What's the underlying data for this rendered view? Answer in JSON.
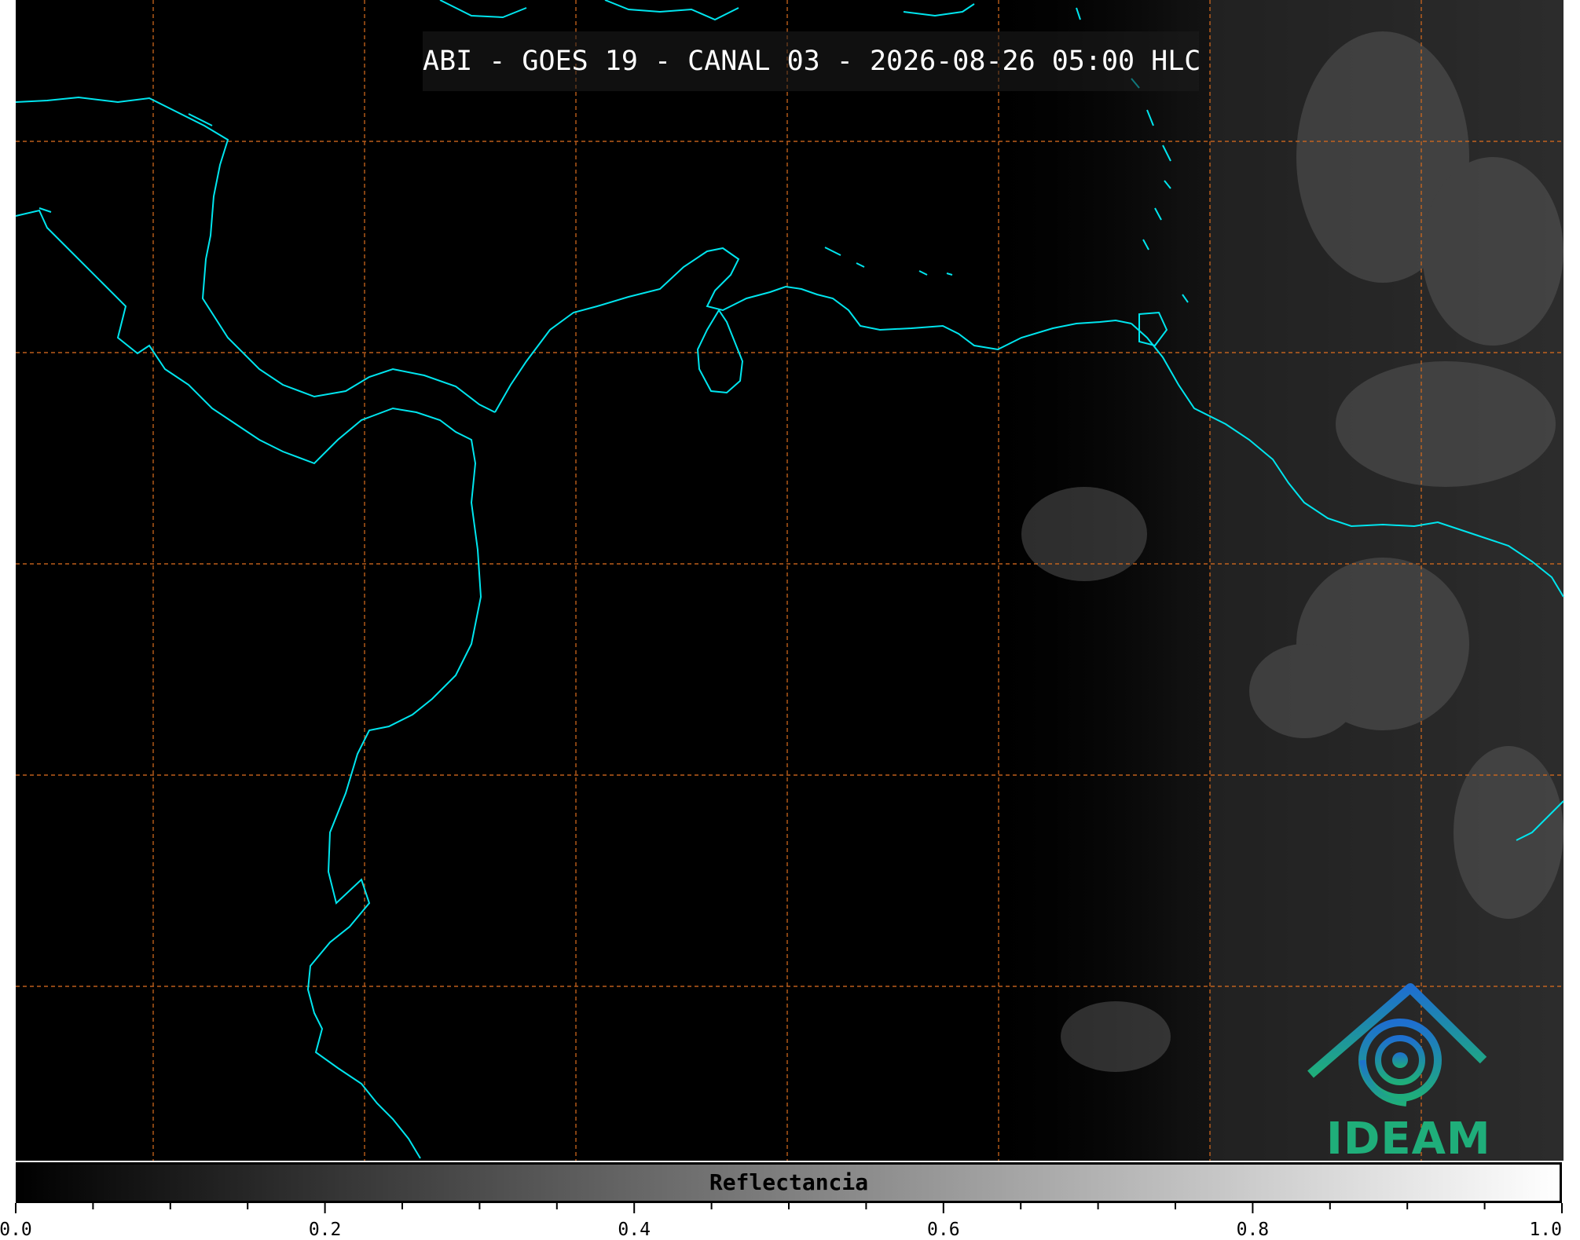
{
  "title": "ABI - GOES 19 - CANAL 03 - 2026-08-26 05:00 HLC",
  "logo": {
    "text": "IDEAM",
    "colors": {
      "top": "#1e6fd0",
      "bottom": "#1fae7a"
    }
  },
  "colorbar": {
    "label": "Reflectancia",
    "range": [
      0.0,
      1.0
    ],
    "colormap": "gray",
    "ticks": [
      "0.0",
      "0.2",
      "0.4",
      "0.6",
      "0.8",
      "1.0"
    ]
  },
  "colors": {
    "background": "#000000",
    "coastline": "#00e5ee",
    "gridlines": "#d2691e"
  }
}
